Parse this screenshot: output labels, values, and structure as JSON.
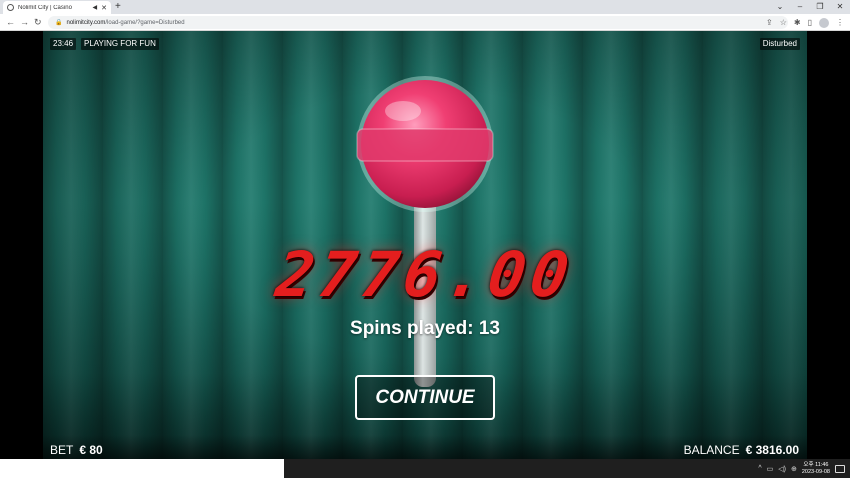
{
  "browser": {
    "tab_title": "Nolimit City | Casino",
    "new_tab": "+",
    "url_host": "nolimitcity.com",
    "url_path": "/load-game/?game=Disturbed",
    "window_controls": [
      "⌄",
      "–",
      "❐",
      "✕"
    ]
  },
  "game": {
    "clock": "23:46",
    "mode": "PLAYING FOR FUN",
    "game_name": "Disturbed",
    "win_amount": "2776.00",
    "spins_played": "Spins played: 13",
    "continue_label": "CONTINUE",
    "bet_label": "BET",
    "bet_value": "€ 80",
    "balance_label": "BALANCE",
    "balance_value": "€ 3816.00"
  },
  "taskbar": {
    "time_line1": "오후 11:46",
    "time_line2": "2023-09-08"
  },
  "colors": {
    "curtain": "#1f7a6d",
    "digits": "#e41e1e",
    "candy": "#e8356a"
  },
  "icons": [
    "globe-icon",
    "speaker-icon",
    "close-icon",
    "back-icon",
    "forward-icon",
    "reload-icon",
    "lock-icon",
    "share-icon",
    "star-icon",
    "extensions-icon",
    "sidepanel-icon",
    "profile-icon",
    "menu-icon",
    "tray-chevron-icon",
    "network-icon",
    "volume-icon",
    "notification-icon"
  ]
}
